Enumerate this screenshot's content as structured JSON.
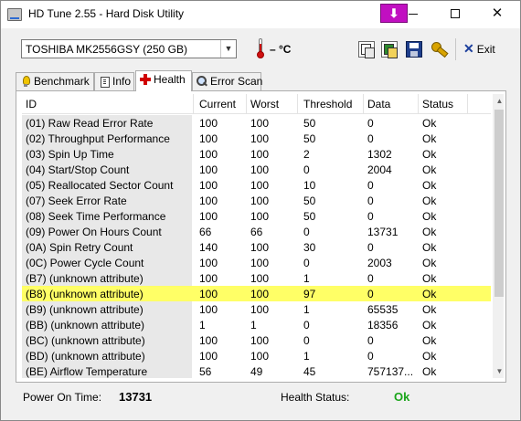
{
  "window": {
    "title": "HD Tune 2.55 - Hard Disk Utility",
    "purple_button_glyph": "⬇",
    "close_glyph": "✕"
  },
  "toolbar": {
    "drive": "TOSHIBA MK2556GSY (250 GB)",
    "temperature": "– °C",
    "exit_label": "Exit",
    "exit_glyph": "✕"
  },
  "tabs": [
    {
      "label": "Benchmark",
      "icon": "lightbulb-icon"
    },
    {
      "label": "Info",
      "icon": "document-icon"
    },
    {
      "label": "Health",
      "icon": "red-cross-icon",
      "active": true
    },
    {
      "label": "Error Scan",
      "icon": "magnifier-icon"
    }
  ],
  "table": {
    "headers": {
      "id": "ID",
      "current": "Current",
      "worst": "Worst",
      "threshold": "Threshold",
      "data": "Data",
      "status": "Status"
    },
    "rows": [
      {
        "id": "(01) Raw Read Error Rate",
        "current": "100",
        "worst": "100",
        "threshold": "50",
        "data": "0",
        "status": "Ok"
      },
      {
        "id": "(02) Throughput Performance",
        "current": "100",
        "worst": "100",
        "threshold": "50",
        "data": "0",
        "status": "Ok"
      },
      {
        "id": "(03) Spin Up Time",
        "current": "100",
        "worst": "100",
        "threshold": "2",
        "data": "1302",
        "status": "Ok"
      },
      {
        "id": "(04) Start/Stop Count",
        "current": "100",
        "worst": "100",
        "threshold": "0",
        "data": "2004",
        "status": "Ok"
      },
      {
        "id": "(05) Reallocated Sector Count",
        "current": "100",
        "worst": "100",
        "threshold": "10",
        "data": "0",
        "status": "Ok"
      },
      {
        "id": "(07) Seek Error Rate",
        "current": "100",
        "worst": "100",
        "threshold": "50",
        "data": "0",
        "status": "Ok"
      },
      {
        "id": "(08) Seek Time Performance",
        "current": "100",
        "worst": "100",
        "threshold": "50",
        "data": "0",
        "status": "Ok"
      },
      {
        "id": "(09) Power On Hours Count",
        "current": "66",
        "worst": "66",
        "threshold": "0",
        "data": "13731",
        "status": "Ok"
      },
      {
        "id": "(0A) Spin Retry Count",
        "current": "140",
        "worst": "100",
        "threshold": "30",
        "data": "0",
        "status": "Ok"
      },
      {
        "id": "(0C) Power Cycle Count",
        "current": "100",
        "worst": "100",
        "threshold": "0",
        "data": "2003",
        "status": "Ok"
      },
      {
        "id": "(B7) (unknown attribute)",
        "current": "100",
        "worst": "100",
        "threshold": "1",
        "data": "0",
        "status": "Ok"
      },
      {
        "id": "(B8) (unknown attribute)",
        "current": "100",
        "worst": "100",
        "threshold": "97",
        "data": "0",
        "status": "Ok",
        "highlight": true
      },
      {
        "id": "(B9) (unknown attribute)",
        "current": "100",
        "worst": "100",
        "threshold": "1",
        "data": "65535",
        "status": "Ok"
      },
      {
        "id": "(BB) (unknown attribute)",
        "current": "1",
        "worst": "1",
        "threshold": "0",
        "data": "18356",
        "status": "Ok"
      },
      {
        "id": "(BC) (unknown attribute)",
        "current": "100",
        "worst": "100",
        "threshold": "0",
        "data": "0",
        "status": "Ok"
      },
      {
        "id": "(BD) (unknown attribute)",
        "current": "100",
        "worst": "100",
        "threshold": "1",
        "data": "0",
        "status": "Ok"
      },
      {
        "id": "(BE) Airflow Temperature",
        "current": "56",
        "worst": "49",
        "threshold": "45",
        "data": "757137...",
        "status": "Ok"
      }
    ]
  },
  "status_bar": {
    "power_on_label": "Power On Time:",
    "power_on_value": "13731",
    "health_label": "Health Status:",
    "health_value": "Ok"
  },
  "colors": {
    "highlight_row": "#ffff66",
    "health_ok": "#1aa51a",
    "purple_button": "#c10fc1"
  }
}
